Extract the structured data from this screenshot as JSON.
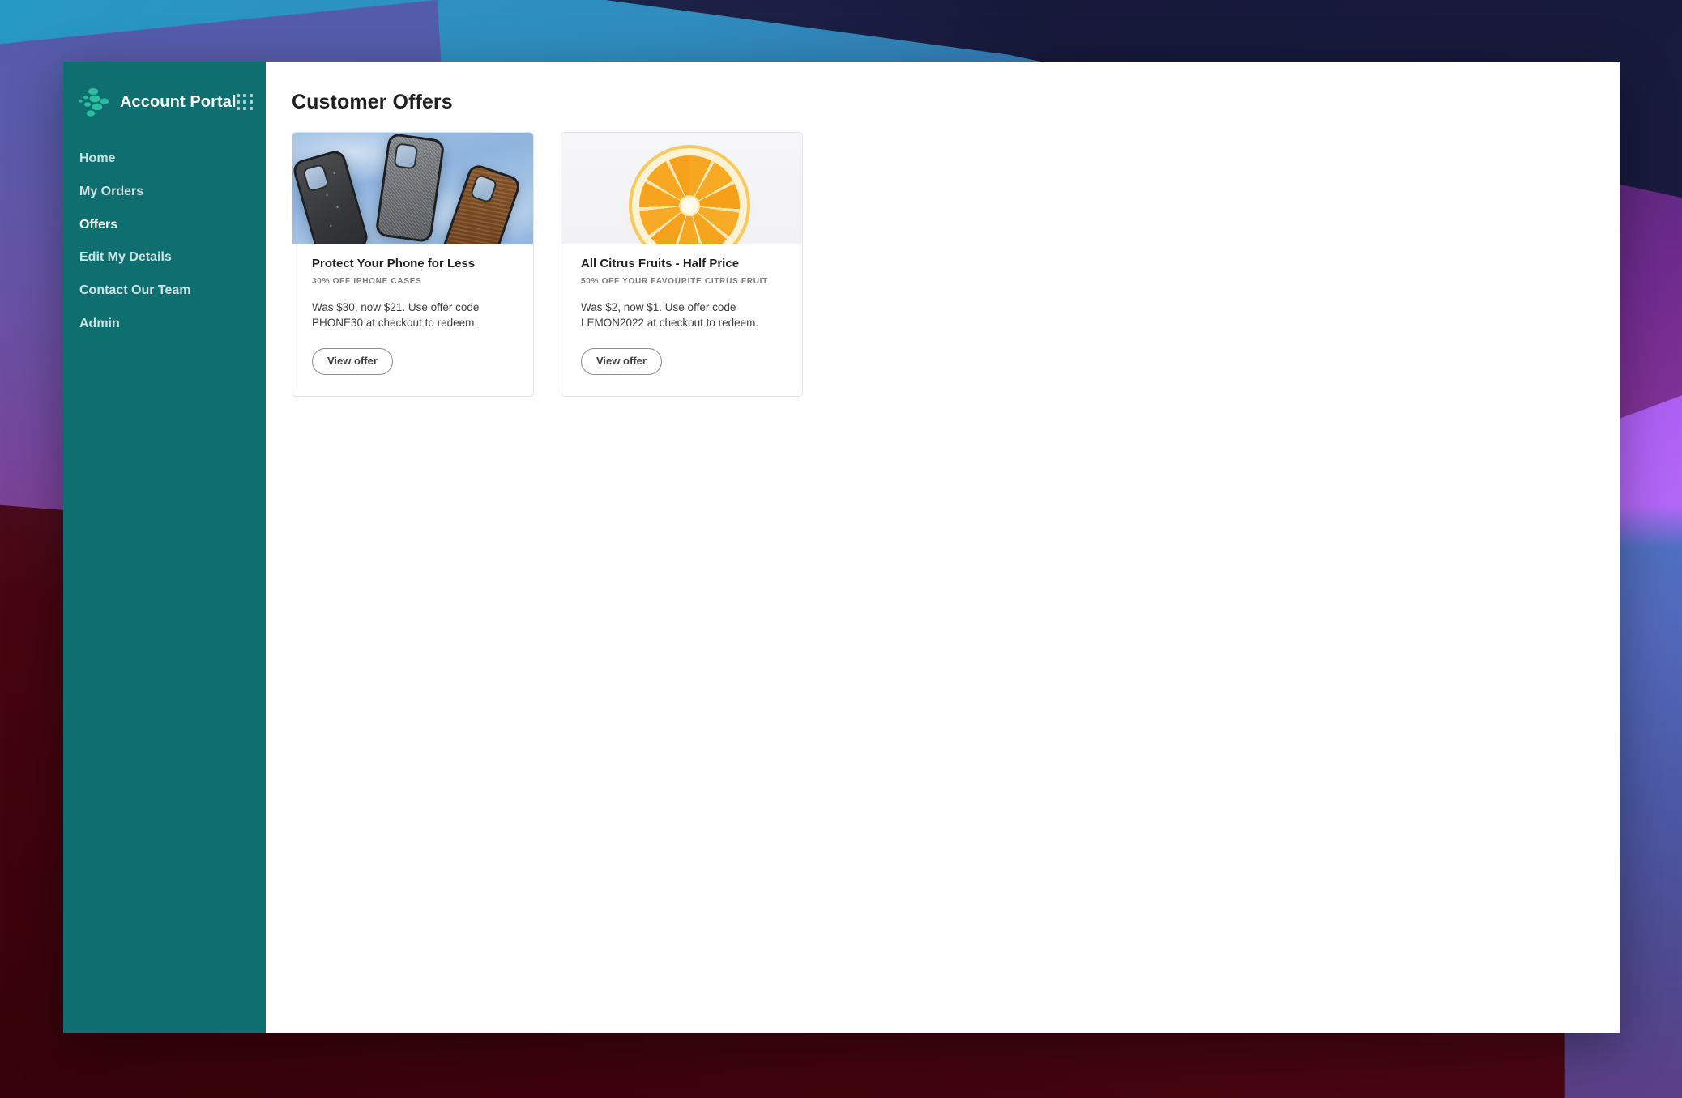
{
  "window": {
    "sidebar_color": "#0f6e70",
    "accent_color": "#0f6e70"
  },
  "sidebar": {
    "brand": {
      "logo_icon": "dot-cluster-logo-icon",
      "title": "Account Portal",
      "app_launcher_icon": "grid-apps-icon"
    },
    "items": [
      {
        "label": "Home",
        "name": "sidebar-item-home",
        "active": false
      },
      {
        "label": "My Orders",
        "name": "sidebar-item-my-orders",
        "active": false
      },
      {
        "label": "Offers",
        "name": "sidebar-item-offers",
        "active": true
      },
      {
        "label": "Edit My Details",
        "name": "sidebar-item-edit-my-details",
        "active": false
      },
      {
        "label": "Contact Our Team",
        "name": "sidebar-item-contact-our-team",
        "active": false
      },
      {
        "label": "Admin",
        "name": "sidebar-item-admin",
        "active": false
      }
    ]
  },
  "main": {
    "page_title": "Customer Offers",
    "offers": [
      {
        "image_alt": "three iphone cases against a blue sky",
        "title": "Protect Your Phone for Less",
        "kicker": "30% OFF IPHONE CASES",
        "description": "Was $30, now $21.  Use offer code PHONE30 at checkout to redeem.",
        "button_label": "View offer"
      },
      {
        "image_alt": "halved orange slice on a light background",
        "title": "All Citrus Fruits - Half Price",
        "kicker": "50% OFF YOUR FAVOURITE CITRUS FRUIT",
        "description": "Was $2, now $1.  Use offer code LEMON2022 at checkout to redeem.",
        "button_label": "View offer"
      }
    ]
  }
}
